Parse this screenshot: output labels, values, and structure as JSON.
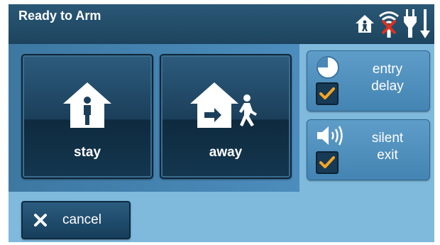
{
  "header": {
    "title": "Ready to Arm",
    "status_icons": [
      "home-person-icon",
      "wifi-off-icon",
      "power-plug-icon",
      "down-arrow-icon"
    ]
  },
  "arm_options": {
    "stay": {
      "label": "stay",
      "icon": "house-person-icon"
    },
    "away": {
      "label": "away",
      "icon": "house-walk-out-icon"
    }
  },
  "settings": {
    "entry_delay": {
      "label_line1": "entry",
      "label_line2": "delay",
      "checked": true,
      "icon": "clock-icon"
    },
    "silent_exit": {
      "label_line1": "silent",
      "label_line2": "exit",
      "checked": true,
      "icon": "speaker-icon"
    }
  },
  "footer": {
    "cancel_label": "cancel"
  },
  "colors": {
    "header_bg": "#1d445e",
    "panel_bg": "#7fb9dc",
    "button_dark": "#1b3f5a",
    "checkmark": "#f5a623"
  }
}
